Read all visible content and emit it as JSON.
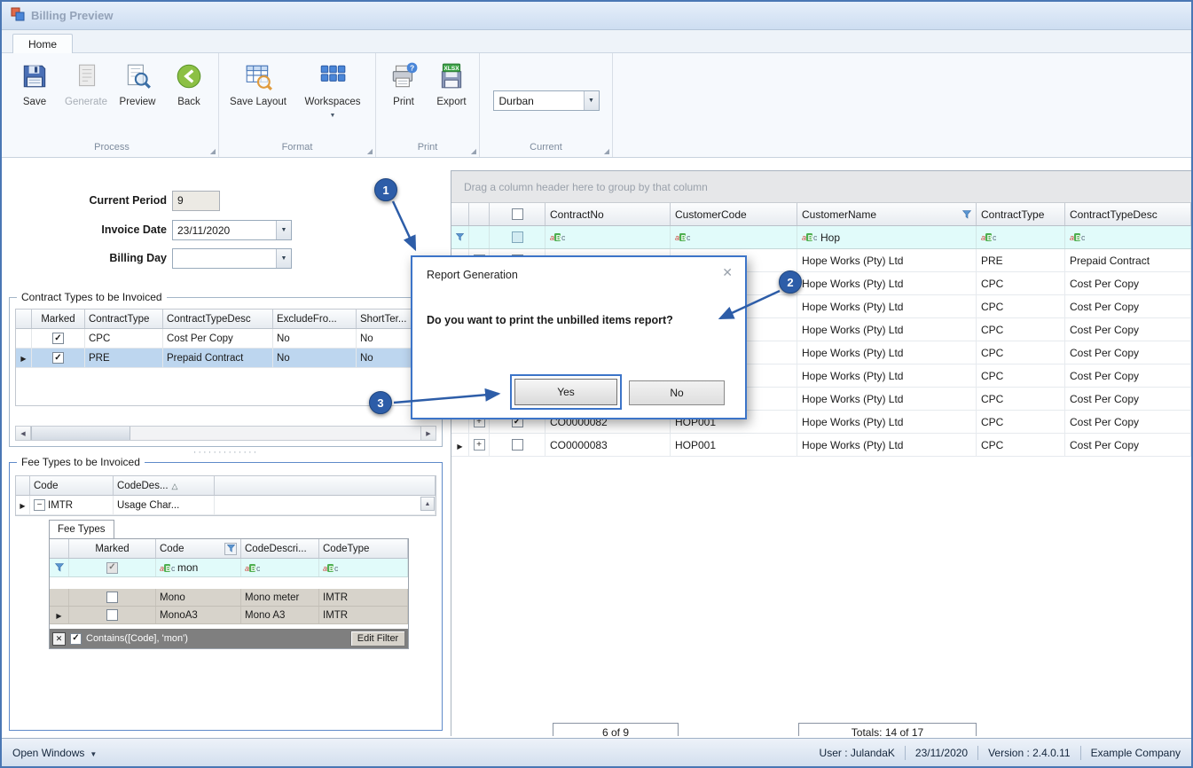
{
  "window": {
    "title": "Billing Preview"
  },
  "ribbon": {
    "home_tab": "Home",
    "buttons": {
      "save": "Save",
      "generate": "Generate",
      "preview": "Preview",
      "back": "Back",
      "save_layout": "Save Layout",
      "workspaces": "Workspaces",
      "print": "Print",
      "export": "Export"
    },
    "groups": {
      "process": "Process",
      "format": "Format",
      "print": "Print",
      "current": "Current"
    },
    "current_selection": "Durban"
  },
  "form": {
    "current_period": {
      "label": "Current Period",
      "value": "9"
    },
    "invoice_date": {
      "label": "Invoice Date",
      "value": "23/11/2020"
    },
    "billing_day": {
      "label": "Billing Day",
      "value": ""
    }
  },
  "contract_types": {
    "title": "Contract Types to be Invoiced",
    "columns": {
      "marked": "Marked",
      "type": "ContractType",
      "desc": "ContractTypeDesc",
      "exclude": "ExcludeFro...",
      "short": "ShortTer..."
    },
    "rows": [
      {
        "marked": true,
        "type": "CPC",
        "desc": "Cost Per Copy",
        "exclude": "No",
        "short": "No"
      },
      {
        "marked": true,
        "type": "PRE",
        "desc": "Prepaid Contract",
        "exclude": "No",
        "short": "No"
      }
    ]
  },
  "fee_types": {
    "title": "Fee Types to be Invoiced",
    "columns": {
      "code": "Code",
      "desc": "CodeDes..."
    },
    "master": {
      "code": "IMTR",
      "desc": "Usage Char..."
    },
    "detail": {
      "tab": "Fee Types",
      "columns": {
        "marked": "Marked",
        "code": "Code",
        "desc": "CodeDescri...",
        "type": "CodeType"
      },
      "filter_value": "mon",
      "rows": [
        {
          "marked": false,
          "code": "Mono",
          "desc": "Mono meter",
          "type": "IMTR"
        },
        {
          "marked": false,
          "code": "MonoA3",
          "desc": "Mono A3",
          "type": "IMTR"
        }
      ],
      "filter_expression": "Contains([Code], 'mon')",
      "edit_filter": "Edit Filter"
    }
  },
  "main_grid": {
    "group_hint": "Drag a column header here to group by that column",
    "columns": {
      "contract_no": "ContractNo",
      "customer_code": "CustomerCode",
      "customer_name": "CustomerName",
      "contract_type": "ContractType",
      "contract_type_desc": "ContractTypeDesc"
    },
    "filter_row": {
      "customer_name": "Hop"
    },
    "rows": [
      {
        "marked": false,
        "contract_no": "",
        "customer_code": "",
        "customer_name": "Hope Works (Pty) Ltd",
        "contract_type": "PRE",
        "contract_type_desc": "Prepaid Contract"
      },
      {
        "marked": false,
        "contract_no": "",
        "customer_code": "",
        "customer_name": "Hope Works (Pty) Ltd",
        "contract_type": "CPC",
        "contract_type_desc": "Cost Per Copy"
      },
      {
        "marked": false,
        "contract_no": "",
        "customer_code": "",
        "customer_name": "Hope Works (Pty) Ltd",
        "contract_type": "CPC",
        "contract_type_desc": "Cost Per Copy"
      },
      {
        "marked": false,
        "contract_no": "",
        "customer_code": "",
        "customer_name": "Hope Works (Pty) Ltd",
        "contract_type": "CPC",
        "contract_type_desc": "Cost Per Copy"
      },
      {
        "marked": false,
        "contract_no": "",
        "customer_code": "",
        "customer_name": "Hope Works (Pty) Ltd",
        "contract_type": "CPC",
        "contract_type_desc": "Cost Per Copy"
      },
      {
        "marked": false,
        "contract_no": "",
        "customer_code": "",
        "customer_name": "Hope Works (Pty) Ltd",
        "contract_type": "CPC",
        "contract_type_desc": "Cost Per Copy"
      },
      {
        "marked": false,
        "contract_no": "",
        "customer_code": "",
        "customer_name": "Hope Works (Pty) Ltd",
        "contract_type": "CPC",
        "contract_type_desc": "Cost Per Copy"
      },
      {
        "marked": true,
        "contract_no": "CO0000082",
        "customer_code": "HOP001",
        "customer_name": "Hope Works (Pty) Ltd",
        "contract_type": "CPC",
        "contract_type_desc": "Cost Per Copy"
      },
      {
        "marked": false,
        "contract_no": "CO0000083",
        "customer_code": "HOP001",
        "customer_name": "Hope Works (Pty) Ltd",
        "contract_type": "CPC",
        "contract_type_desc": "Cost Per Copy"
      }
    ],
    "footer": {
      "count": "6 of 9",
      "totals": "Totals: 14 of 17"
    }
  },
  "dialog": {
    "title": "Report Generation",
    "message": "Do you want to print the unbilled items report?",
    "yes": "Yes",
    "no": "No"
  },
  "annotations": {
    "step1": "1",
    "step2": "2",
    "step3": "3"
  },
  "status_bar": {
    "open_windows": "Open Windows",
    "user": "User : JulandaK",
    "date": "23/11/2020",
    "version": "Version : 2.4.0.11",
    "company": "Example Company"
  },
  "colors": {
    "accent": "#2d5da8",
    "dialog_border": "#3c74c8",
    "filter_row": "#e1fbfa",
    "selection": "#bdd6ef"
  }
}
